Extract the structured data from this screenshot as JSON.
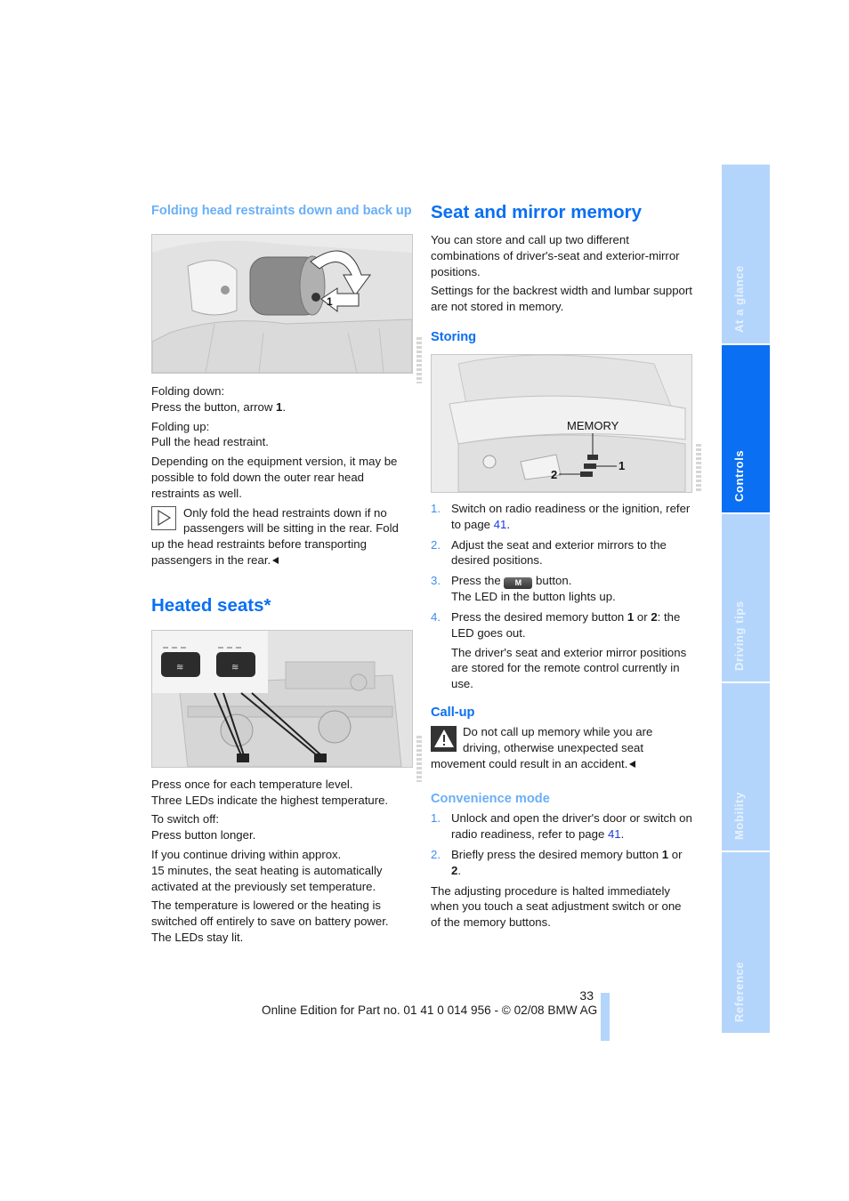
{
  "left_column": {
    "head_restraints": {
      "heading": "Folding head restraints down and back up",
      "figure_label": "1",
      "paragraphs": {
        "fold_down_label": "Folding down:",
        "fold_down_text_pre": "Press the button, arrow ",
        "fold_down_bold": "1",
        "fold_down_text_post": ".",
        "fold_up_label": "Folding up:",
        "fold_up_text": "Pull the head restraint.",
        "equipment": "Depending on the equipment version, it may be possible to fold down the outer rear head restraints as well."
      },
      "note": {
        "icon": "note-triangle-icon",
        "text": "Only fold the head restraints down if no passengers will be sitting in the rear. Fold up the head restraints before transporting passengers in the rear."
      }
    },
    "heated_seats": {
      "heading": "Heated seats*",
      "paragraphs": {
        "press_once": "Press once for each temperature level.",
        "three_leds": "Three LEDs indicate the highest temperature.",
        "switch_off_label": "To switch off:",
        "switch_off_text": "Press button longer.",
        "continue_1": "If you continue driving within approx.",
        "continue_2": "15 minutes, the seat heating is automatically activated at the previously set temperature.",
        "lowered": "The temperature is lowered or the heating is switched off entirely to save on battery power.",
        "leds_lit": "The LEDs stay lit."
      }
    }
  },
  "right_column": {
    "heading": "Seat and mirror memory",
    "intro_1": "You can store and call up two different combinations of driver's-seat and exterior-mirror positions.",
    "intro_2": "Settings for the backrest width and lumbar support are not stored in memory.",
    "storing": {
      "heading": "Storing",
      "figure": {
        "memory_label": "MEMORY",
        "callout_1": "1",
        "callout_2": "2"
      },
      "steps": [
        {
          "num": "1.",
          "text": "Switch on radio readiness or the ignition, refer to page ",
          "link": "41",
          "tail": "."
        },
        {
          "num": "2.",
          "text": "Adjust the seat and exterior mirrors to the desired positions."
        },
        {
          "num": "3.",
          "pre": "Press the ",
          "button_label": "M",
          "post": " button.",
          "line2": "The LED in the button lights up."
        },
        {
          "num": "4.",
          "pre": "Press the desired memory button ",
          "b1": "1",
          "mid": " or ",
          "b2": "2",
          "post": ": the LED goes out."
        }
      ],
      "after_steps": "The driver's seat and exterior mirror positions are stored for the remote control currently in use."
    },
    "callup": {
      "heading": "Call-up",
      "warning": {
        "icon": "warning-icon",
        "text": "Do not call up memory while you are driving, otherwise unexpected seat movement could result in an accident."
      }
    },
    "convenience": {
      "heading": "Convenience mode",
      "steps": [
        {
          "num": "1.",
          "text": "Unlock and open the driver's door or switch on radio readiness, refer to page ",
          "link": "41",
          "tail": "."
        },
        {
          "num": "2.",
          "pre": "Briefly press the desired memory button ",
          "b1": "1",
          "mid": " or ",
          "b2": "2",
          "post": "."
        }
      ],
      "closing": "The adjusting procedure is halted immediately when you touch a seat adjustment switch or one of the memory buttons."
    }
  },
  "side_tabs": [
    {
      "label": "At a glance",
      "active": false
    },
    {
      "label": "Controls",
      "active": true
    },
    {
      "label": "Driving tips",
      "active": false
    },
    {
      "label": "Mobility",
      "active": false
    },
    {
      "label": "Reference",
      "active": false
    }
  ],
  "footer": {
    "page_number": "33",
    "edition": "Online Edition for Part no. 01 41 0 014 956 - © 02/08 BMW AG"
  },
  "colors": {
    "heading_blue": "#0a6ff2",
    "light_blue": "#6aaff7",
    "tab_inactive": "#b4d5fb",
    "link": "#1a3ae0"
  }
}
